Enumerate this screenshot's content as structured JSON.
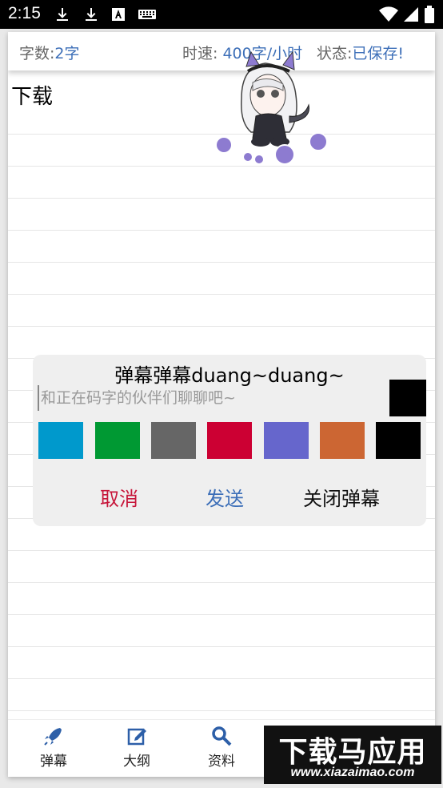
{
  "status_bar": {
    "time": "2:15",
    "icons": [
      "download-icon",
      "download-icon",
      "font-icon",
      "keyboard-icon",
      "wifi-icon",
      "signal-icon",
      "battery-icon"
    ]
  },
  "info_bar": {
    "word_count_label": "字数:",
    "word_count_value": "2字",
    "speed_label": "时速:",
    "speed_value": "400字/小时",
    "status_label": "状态:",
    "status_value": "已保存!"
  },
  "document": {
    "text": "下载"
  },
  "danmaku_dialog": {
    "title": "弹幕弹幕duang~duang~",
    "input_value": "",
    "input_placeholder": "和正在码字的伙伴们聊聊吧~",
    "selected_color": "#000000",
    "colors": [
      "#0099cc",
      "#009933",
      "#666666",
      "#cc0033",
      "#6666cc",
      "#cc6633",
      "#000000"
    ],
    "cancel_label": "取消",
    "send_label": "发送",
    "close_label": "关闭弹幕"
  },
  "toolbar": {
    "items": [
      {
        "label": "弹幕",
        "icon": "rocket-icon"
      },
      {
        "label": "大纲",
        "icon": "edit-icon"
      },
      {
        "label": "资料",
        "icon": "search-icon"
      }
    ]
  },
  "watermark": {
    "main": "下载马应用",
    "sub": "www.xiazaimao.com"
  },
  "colors": {
    "accent_blue": "#3d6fb8",
    "cancel_red": "#c7173b",
    "dialog_bg": "#efefef"
  }
}
